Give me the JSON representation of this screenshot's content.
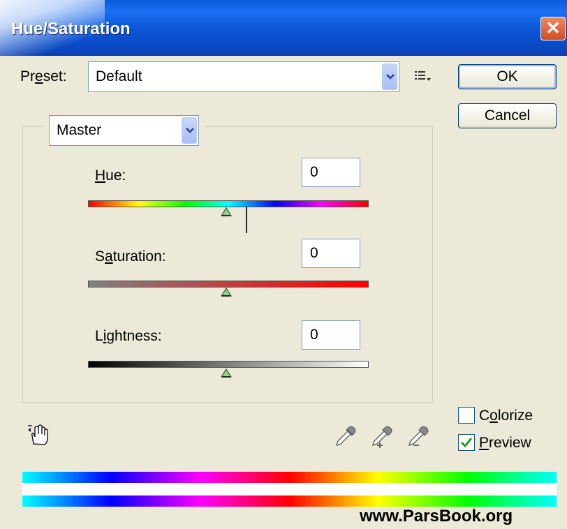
{
  "window": {
    "title": "Hue/Saturation",
    "close_glyph": "✕"
  },
  "preset": {
    "label_pre": "Pr",
    "label_ul": "e",
    "label_post": "set:",
    "value": "Default"
  },
  "buttons": {
    "ok": "OK",
    "cancel": "Cancel"
  },
  "channel": {
    "value": "Master"
  },
  "hue": {
    "label_ul": "H",
    "label_rest": "ue:",
    "value": "0",
    "level": 0
  },
  "saturation": {
    "label_pre": "S",
    "label_ul": "a",
    "label_rest": "turation:",
    "value": "0",
    "level": 0
  },
  "lightness": {
    "label_pre": "L",
    "label_ul": "i",
    "label_rest": "ghtness:",
    "value": "0",
    "level": 0
  },
  "colorize": {
    "label_pre": "C",
    "label_ul": "o",
    "label_rest": "lorize",
    "checked": false
  },
  "preview": {
    "label_ul": "P",
    "label_rest": "review",
    "checked": true
  },
  "icons": [
    "preset-options-icon",
    "hand-adjust-icon",
    "eyedropper-icon",
    "eyedropper-plus-icon",
    "eyedropper-minus-icon"
  ],
  "footer": {
    "text": "www.ParsBook.org"
  }
}
